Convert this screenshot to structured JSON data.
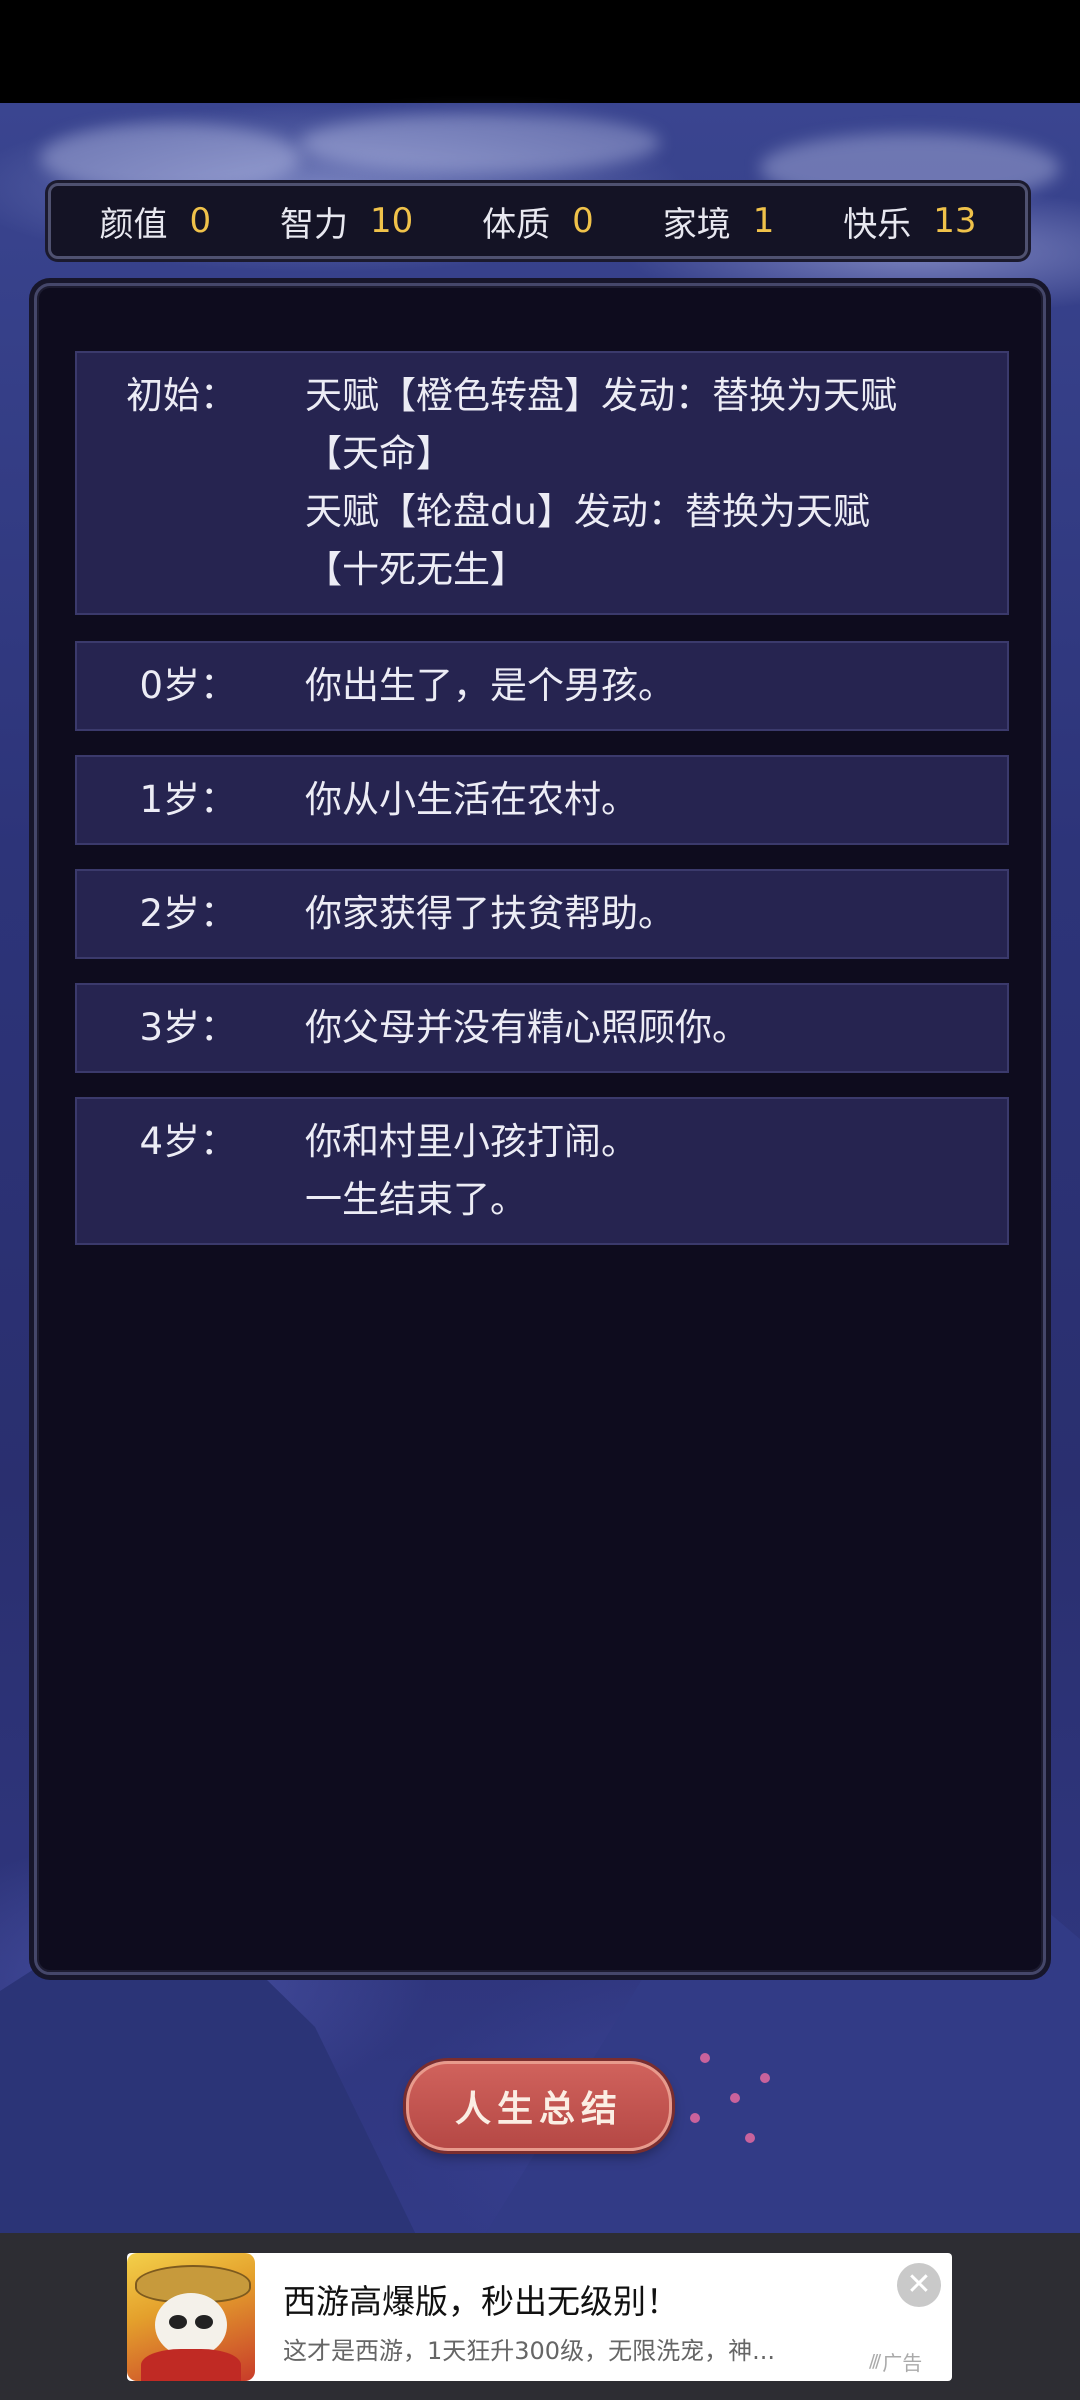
{
  "stats": [
    {
      "label": "颜值",
      "value": "0"
    },
    {
      "label": "智力",
      "value": "10"
    },
    {
      "label": "体质",
      "value": "0"
    },
    {
      "label": "家境",
      "value": "1"
    },
    {
      "label": "快乐",
      "value": "13"
    }
  ],
  "events": [
    {
      "age": "初始：",
      "lines": [
        "天赋【橙色转盘】发动：替换为天赋",
        "【天命】",
        "天赋【轮盘du】发动：替换为天赋",
        "【十死无生】"
      ]
    },
    {
      "age": "0岁：",
      "lines": [
        "你出生了，是个男孩。"
      ]
    },
    {
      "age": "1岁：",
      "lines": [
        "你从小生活在农村。"
      ]
    },
    {
      "age": "2岁：",
      "lines": [
        "你家获得了扶贫帮助。"
      ]
    },
    {
      "age": "3岁：",
      "lines": [
        "你父母并没有精心照顾你。"
      ]
    },
    {
      "age": "4岁：",
      "lines": [
        "你和村里小孩打闹。",
        "一生结束了。"
      ]
    }
  ],
  "summary_button": {
    "label": "人生总结"
  },
  "ad": {
    "title": "西游高爆版，秒出无级别！",
    "description": "这才是西游，1天狂升300级，无限洗宠，神...",
    "badge": "广告",
    "close_symbol": "✕"
  },
  "colors": {
    "stat_value": "#f0c24a",
    "event_background": "#262450",
    "panel_background": "#0e0c1e",
    "button": "#c4524f"
  }
}
